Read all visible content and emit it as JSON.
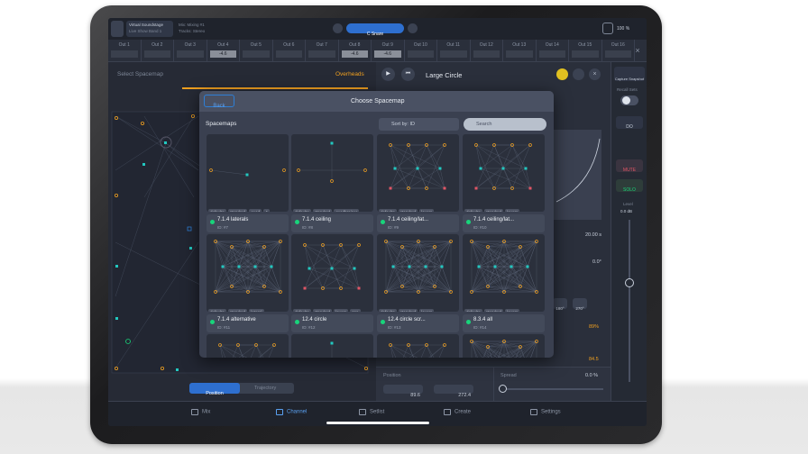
{
  "topbar": {
    "project_line1": "Virtual Soundstage",
    "project_line2": "Live Show Band 1",
    "mix_line1": "Mix: Mixing #1",
    "mix_line2": "Tracks: Stereo",
    "channel": "C Snare",
    "battery": "100 %"
  },
  "outputs": {
    "labels": [
      "Out 1",
      "Out 2",
      "Out 3",
      "Out 4",
      "Out 5",
      "Out 6",
      "Out 7",
      "Out 8",
      "Out 9",
      "Out 10",
      "Out 11",
      "Out 12",
      "Out 13",
      "Out 14",
      "Out 15",
      "Out 16"
    ],
    "values": [
      "",
      "",
      "",
      "-4.6",
      "",
      "",
      "",
      "-4.6",
      "-4.6",
      "",
      "",
      "",
      "",
      "",
      "",
      ""
    ]
  },
  "left_panel": {
    "select_label": "Select Spacemap",
    "overheads": "Overheads",
    "tab_position": "Position",
    "tab_trajectory": "Trajectory"
  },
  "right_panel": {
    "title": "Large Circle",
    "capture": "Capture Snapshot",
    "recall": "Recall Sets",
    "duration": "20.00 s",
    "angle": "0.0°",
    "rot_180": "180°",
    "rot_270": "270°",
    "pct1": "89%",
    "val2": "84.5",
    "position_label": "Position",
    "pos_x": "89.6",
    "pos_y": "272.4",
    "spread_label": "Spread",
    "spread_val": "0.0 %",
    "side_do": "DO",
    "side_mute": "MUTE",
    "side_solo": "SOLO",
    "level_label": "Level",
    "level_val": "0.0 dB"
  },
  "modal": {
    "back": "Back",
    "title": "Choose Spacemap",
    "section": "Spacemaps",
    "sort": "Sort by: ID",
    "search_placeholder": "Search",
    "row1_tags": [
      [
        "defaults",
        "standard",
        "quad",
        "4"
      ],
      [
        "defaults",
        "standard",
        "quadbrainer"
      ],
      [
        "defaults",
        "standard",
        "layers"
      ],
      [
        "defaults",
        "standard",
        "layers"
      ]
    ],
    "row2": [
      {
        "name": "7.1.4 laterals",
        "id": "ID: #7"
      },
      {
        "name": "7.1.4 ceiling",
        "id": "ID: #8"
      },
      {
        "name": "7.1.4 ceiling/lat...",
        "id": "ID: #9"
      },
      {
        "name": "7.1.4 ceiling/lat...",
        "id": "ID: #10"
      }
    ],
    "row2_tags": [
      [
        "defaults",
        "standard",
        "lateral"
      ],
      [
        "defaults",
        "standard",
        "layers",
        "spa"
      ],
      [
        "defaults",
        "standard",
        "layers"
      ],
      [
        "defaults",
        "standard",
        "layers"
      ]
    ],
    "row3": [
      {
        "name": "7.1.4 alternative",
        "id": "ID: #11"
      },
      {
        "name": "12.4 circle",
        "id": "ID: #12"
      },
      {
        "name": "12.4 circle scr...",
        "id": "ID: #13"
      },
      {
        "name": "8.3.4 all",
        "id": "ID: #14"
      }
    ]
  },
  "bottom_tabs": [
    "Mix",
    "Channel",
    "Setlist",
    "Create",
    "Settings"
  ],
  "colors": {
    "accent": "#f0a020",
    "teal": "#22c8c0",
    "green": "#18d47a",
    "red": "#e05565",
    "blue": "#2e7fd6"
  }
}
